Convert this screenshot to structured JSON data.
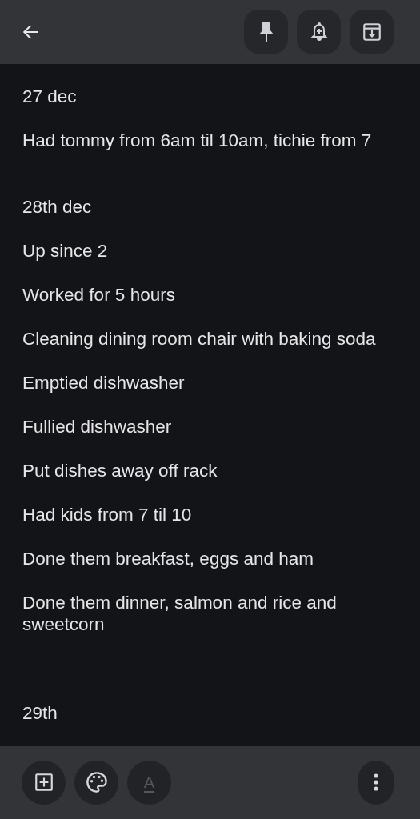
{
  "top_bar": {
    "buttons": [
      {
        "kind": "pin"
      },
      {
        "kind": "reminder"
      },
      {
        "kind": "archive"
      }
    ]
  },
  "lines": [
    {
      "kind": "text",
      "text": "27 dec"
    },
    {
      "kind": "text",
      "text": "Had tommy from 6am til 10am, tichie from 7"
    },
    {
      "kind": "blank"
    },
    {
      "kind": "text",
      "text": "28th dec"
    },
    {
      "kind": "text",
      "text": "Up since 2"
    },
    {
      "kind": "text",
      "text": "Worked for 5 hours"
    },
    {
      "kind": "text",
      "text": "Cleaning dining room chair with baking soda"
    },
    {
      "kind": "text",
      "text": "Emptied dishwasher"
    },
    {
      "kind": "text",
      "text": "Fullied dishwasher"
    },
    {
      "kind": "text",
      "text": "Put dishes away off rack"
    },
    {
      "kind": "text",
      "text": "Had kids from 7 til 10"
    },
    {
      "kind": "text",
      "text": "Done them breakfast, eggs and ham"
    },
    {
      "kind": "text",
      "text": "Done them dinner, salmon and rice and sweetcorn"
    },
    {
      "kind": "blank"
    },
    {
      "kind": "blank"
    },
    {
      "kind": "text",
      "text": "29th"
    }
  ],
  "bottom_bar": {
    "text_format": {
      "label": "A",
      "disabled": true
    }
  }
}
